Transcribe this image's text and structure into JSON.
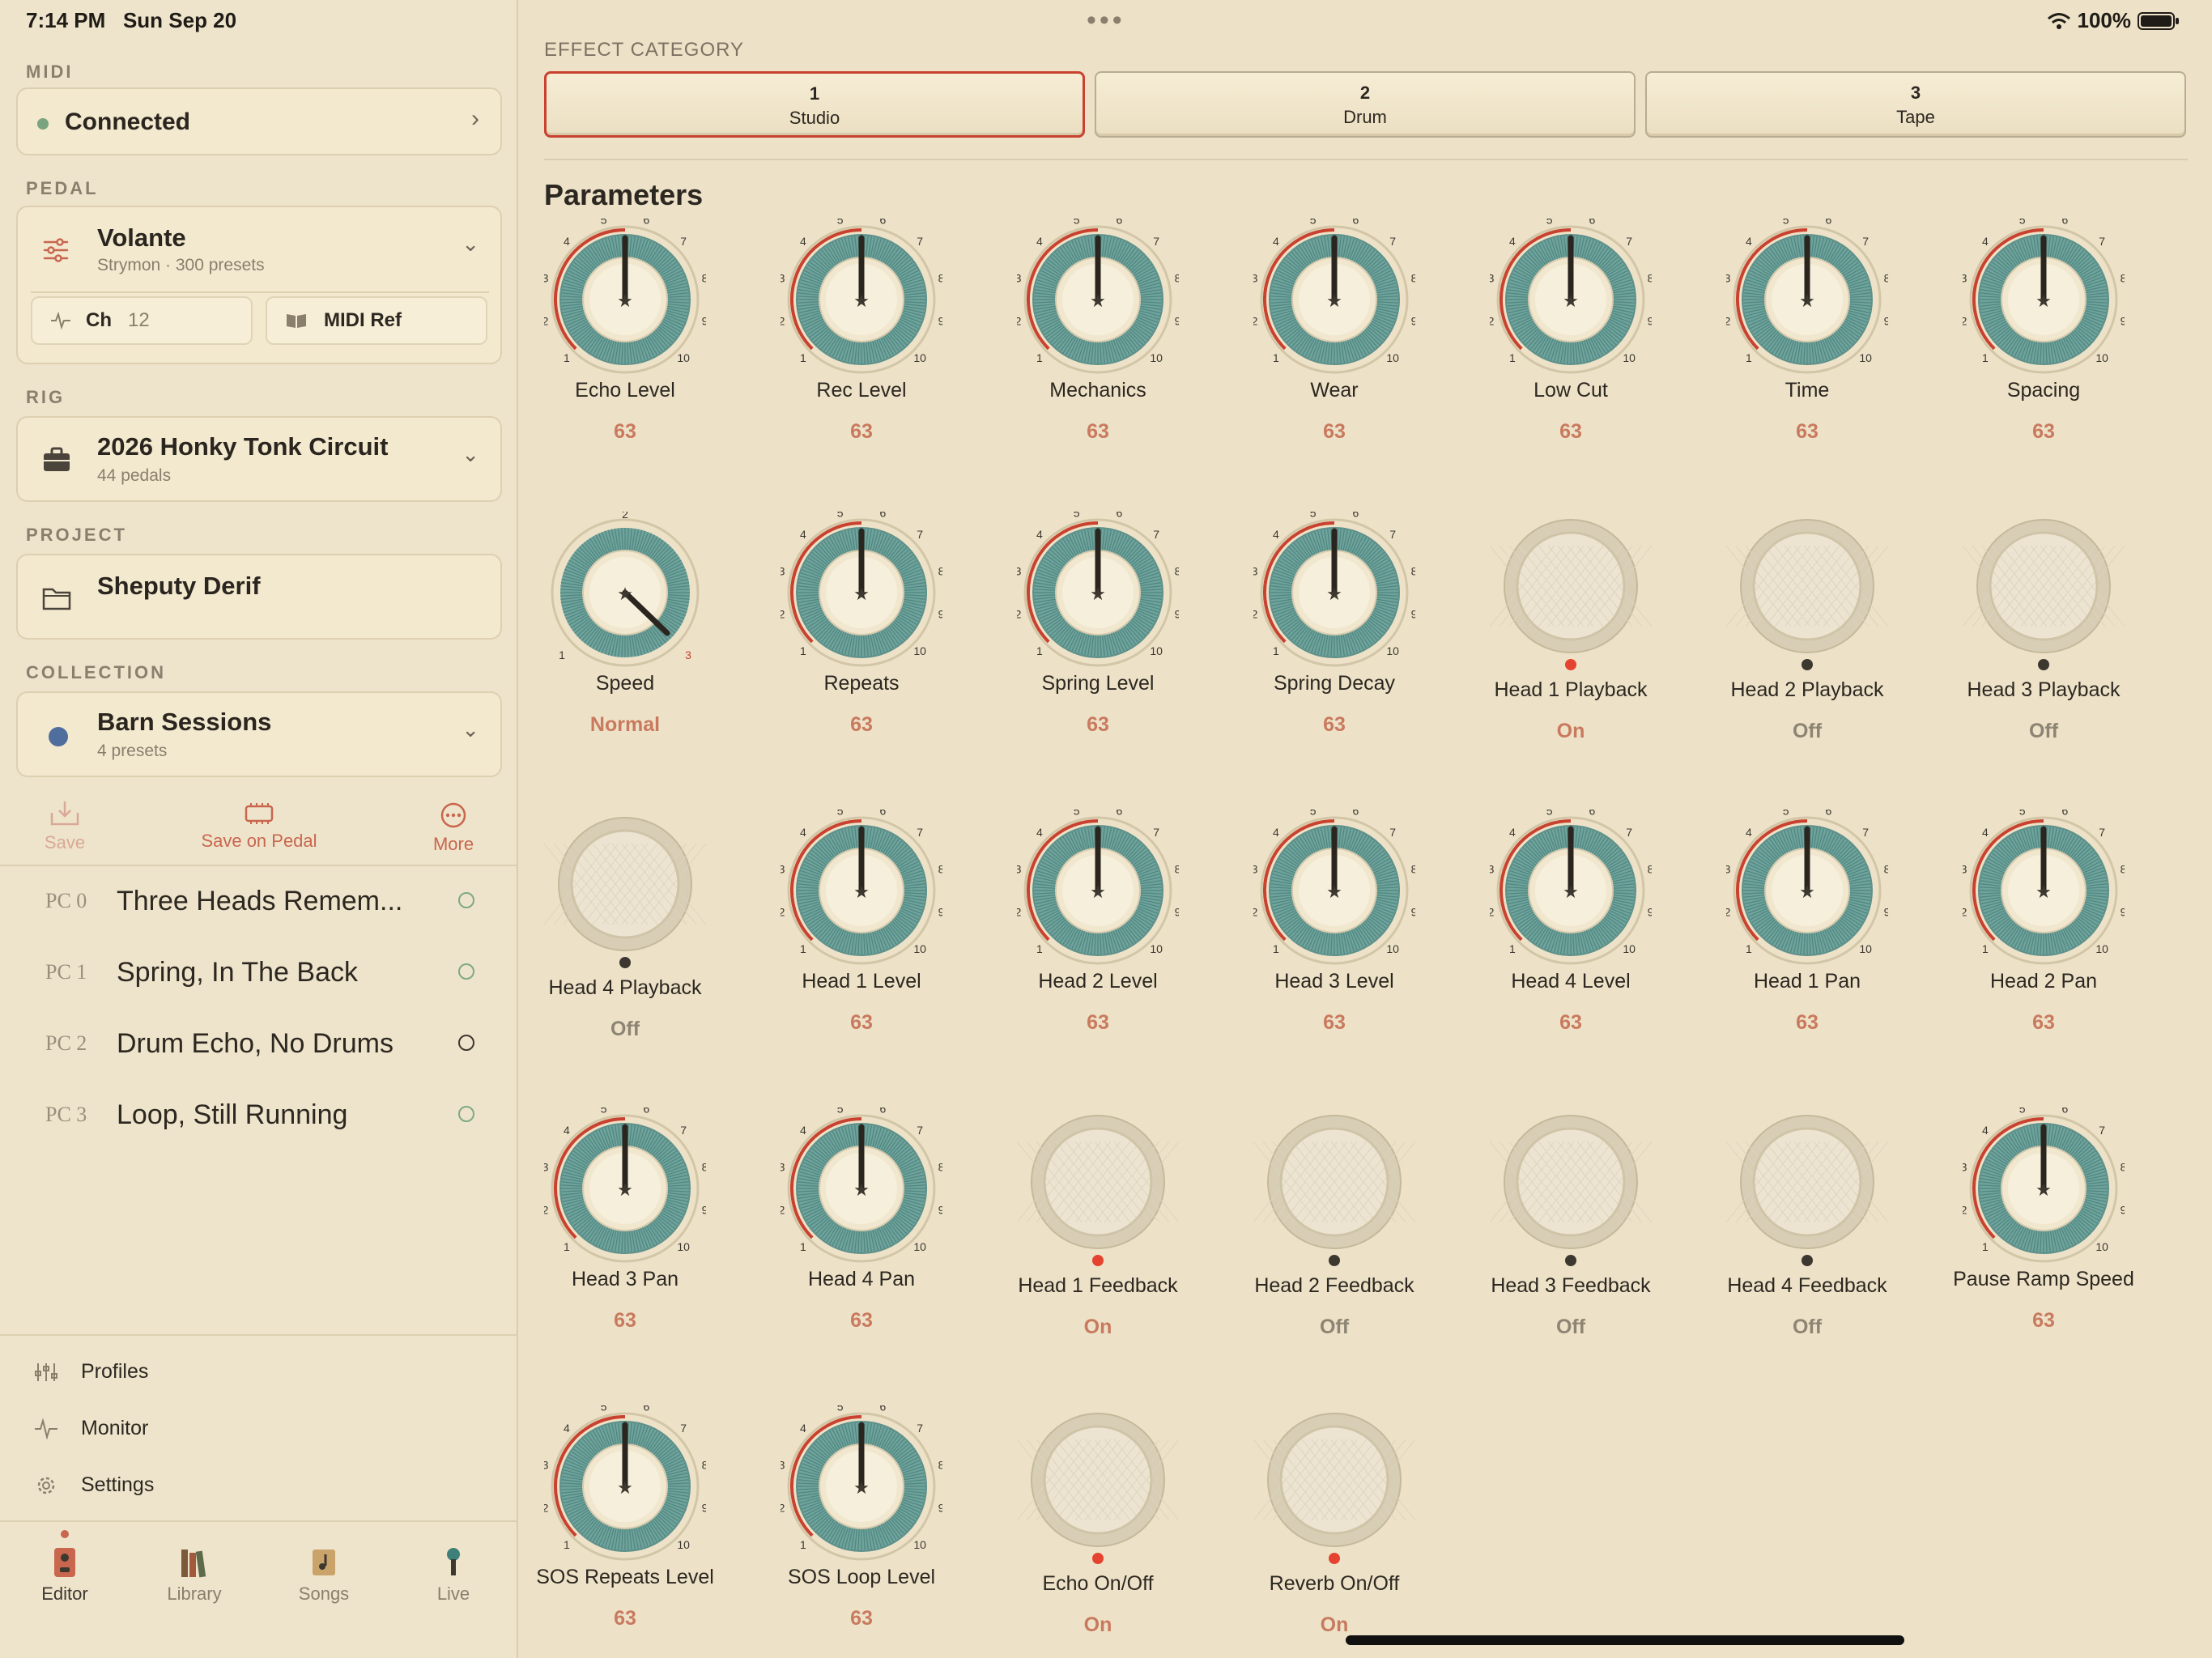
{
  "status": {
    "time": "7:14 PM",
    "date": "Sun Sep 20",
    "battery": "100%"
  },
  "sidebar": {
    "midi": {
      "label": "MIDI",
      "status": "Connected"
    },
    "pedal": {
      "label": "PEDAL",
      "name": "Volante",
      "sub": "Strymon · 300 presets",
      "channel_label": "Ch",
      "channel_value": "12",
      "midi_ref": "MIDI Ref"
    },
    "rig": {
      "label": "RIG",
      "name": "2026 Honky Tonk Circuit",
      "sub": "44 pedals"
    },
    "project": {
      "label": "PROJECT",
      "name": "Sheputy Derif"
    },
    "collection": {
      "label": "COLLECTION",
      "name": "Barn Sessions",
      "sub": "4 presets",
      "color": "#4f6e9e"
    },
    "actions": {
      "save": "Save",
      "save_on_pedal": "Save on Pedal",
      "more": "More"
    },
    "presets": [
      {
        "pc": "PC 0",
        "name": "Three Heads Remem..."
      },
      {
        "pc": "PC 1",
        "name": "Spring, In The Back"
      },
      {
        "pc": "PC 2",
        "name": "Drum Echo, No Drums"
      },
      {
        "pc": "PC 3",
        "name": "Loop, Still Running"
      }
    ],
    "utility": {
      "profiles": "Profiles",
      "monitor": "Monitor",
      "settings": "Settings"
    },
    "tabs": {
      "editor": "Editor",
      "library": "Library",
      "songs": "Songs",
      "live": "Live"
    }
  },
  "main": {
    "effect_category_label": "EFFECT CATEGORY",
    "categories": [
      {
        "num": "1",
        "label": "Studio"
      },
      {
        "num": "2",
        "label": "Drum"
      },
      {
        "num": "3",
        "label": "Tape"
      }
    ],
    "parameters_title": "Parameters",
    "params": [
      {
        "name": "Echo Level",
        "type": "knob",
        "value": "63"
      },
      {
        "name": "Rec Level",
        "type": "knob",
        "value": "63"
      },
      {
        "name": "Mechanics",
        "type": "knob",
        "value": "63"
      },
      {
        "name": "Wear",
        "type": "knob",
        "value": "63"
      },
      {
        "name": "Low Cut",
        "type": "knob",
        "value": "63"
      },
      {
        "name": "Time",
        "type": "knob",
        "value": "63"
      },
      {
        "name": "Spacing",
        "type": "knob",
        "value": "63"
      },
      {
        "name": "Speed",
        "type": "switch3",
        "value": "Normal"
      },
      {
        "name": "Repeats",
        "type": "knob",
        "value": "63"
      },
      {
        "name": "Spring Level",
        "type": "knob",
        "value": "63"
      },
      {
        "name": "Spring Decay",
        "type": "knob",
        "value": "63"
      },
      {
        "name": "Head 1 Playback",
        "type": "button",
        "value": "On"
      },
      {
        "name": "Head 2 Playback",
        "type": "button",
        "value": "Off"
      },
      {
        "name": "Head 3 Playback",
        "type": "button",
        "value": "Off"
      },
      {
        "name": "Head 4 Playback",
        "type": "button",
        "value": "Off"
      },
      {
        "name": "Head 1 Level",
        "type": "knob",
        "value": "63"
      },
      {
        "name": "Head 2 Level",
        "type": "knob",
        "value": "63"
      },
      {
        "name": "Head 3 Level",
        "type": "knob",
        "value": "63"
      },
      {
        "name": "Head 4 Level",
        "type": "knob",
        "value": "63"
      },
      {
        "name": "Head 1 Pan",
        "type": "knob",
        "value": "63"
      },
      {
        "name": "Head 2 Pan",
        "type": "knob",
        "value": "63"
      },
      {
        "name": "Head 3 Pan",
        "type": "knob",
        "value": "63"
      },
      {
        "name": "Head 4 Pan",
        "type": "knob",
        "value": "63"
      },
      {
        "name": "Head 1 Feedback",
        "type": "button",
        "value": "On"
      },
      {
        "name": "Head 2 Feedback",
        "type": "button",
        "value": "Off"
      },
      {
        "name": "Head 3 Feedback",
        "type": "button",
        "value": "Off"
      },
      {
        "name": "Head 4 Feedback",
        "type": "button",
        "value": "Off"
      },
      {
        "name": "Pause Ramp Speed",
        "type": "knob",
        "value": "63"
      },
      {
        "name": "SOS Repeats Level",
        "type": "knob",
        "value": "63"
      },
      {
        "name": "SOS Loop Level",
        "type": "knob",
        "value": "63"
      },
      {
        "name": "Echo On/Off",
        "type": "button",
        "value": "On"
      },
      {
        "name": "Reverb On/Off",
        "type": "button",
        "value": "On"
      }
    ],
    "knob_scale": [
      "1",
      "2",
      "3",
      "4",
      "5",
      "6",
      "7",
      "8",
      "9",
      "10"
    ],
    "speed_scale": [
      "1",
      "2",
      "3"
    ],
    "colors": {
      "accent": "#c9412f",
      "knob_teal": "#6fa39c",
      "value": "#c97a5e"
    }
  }
}
